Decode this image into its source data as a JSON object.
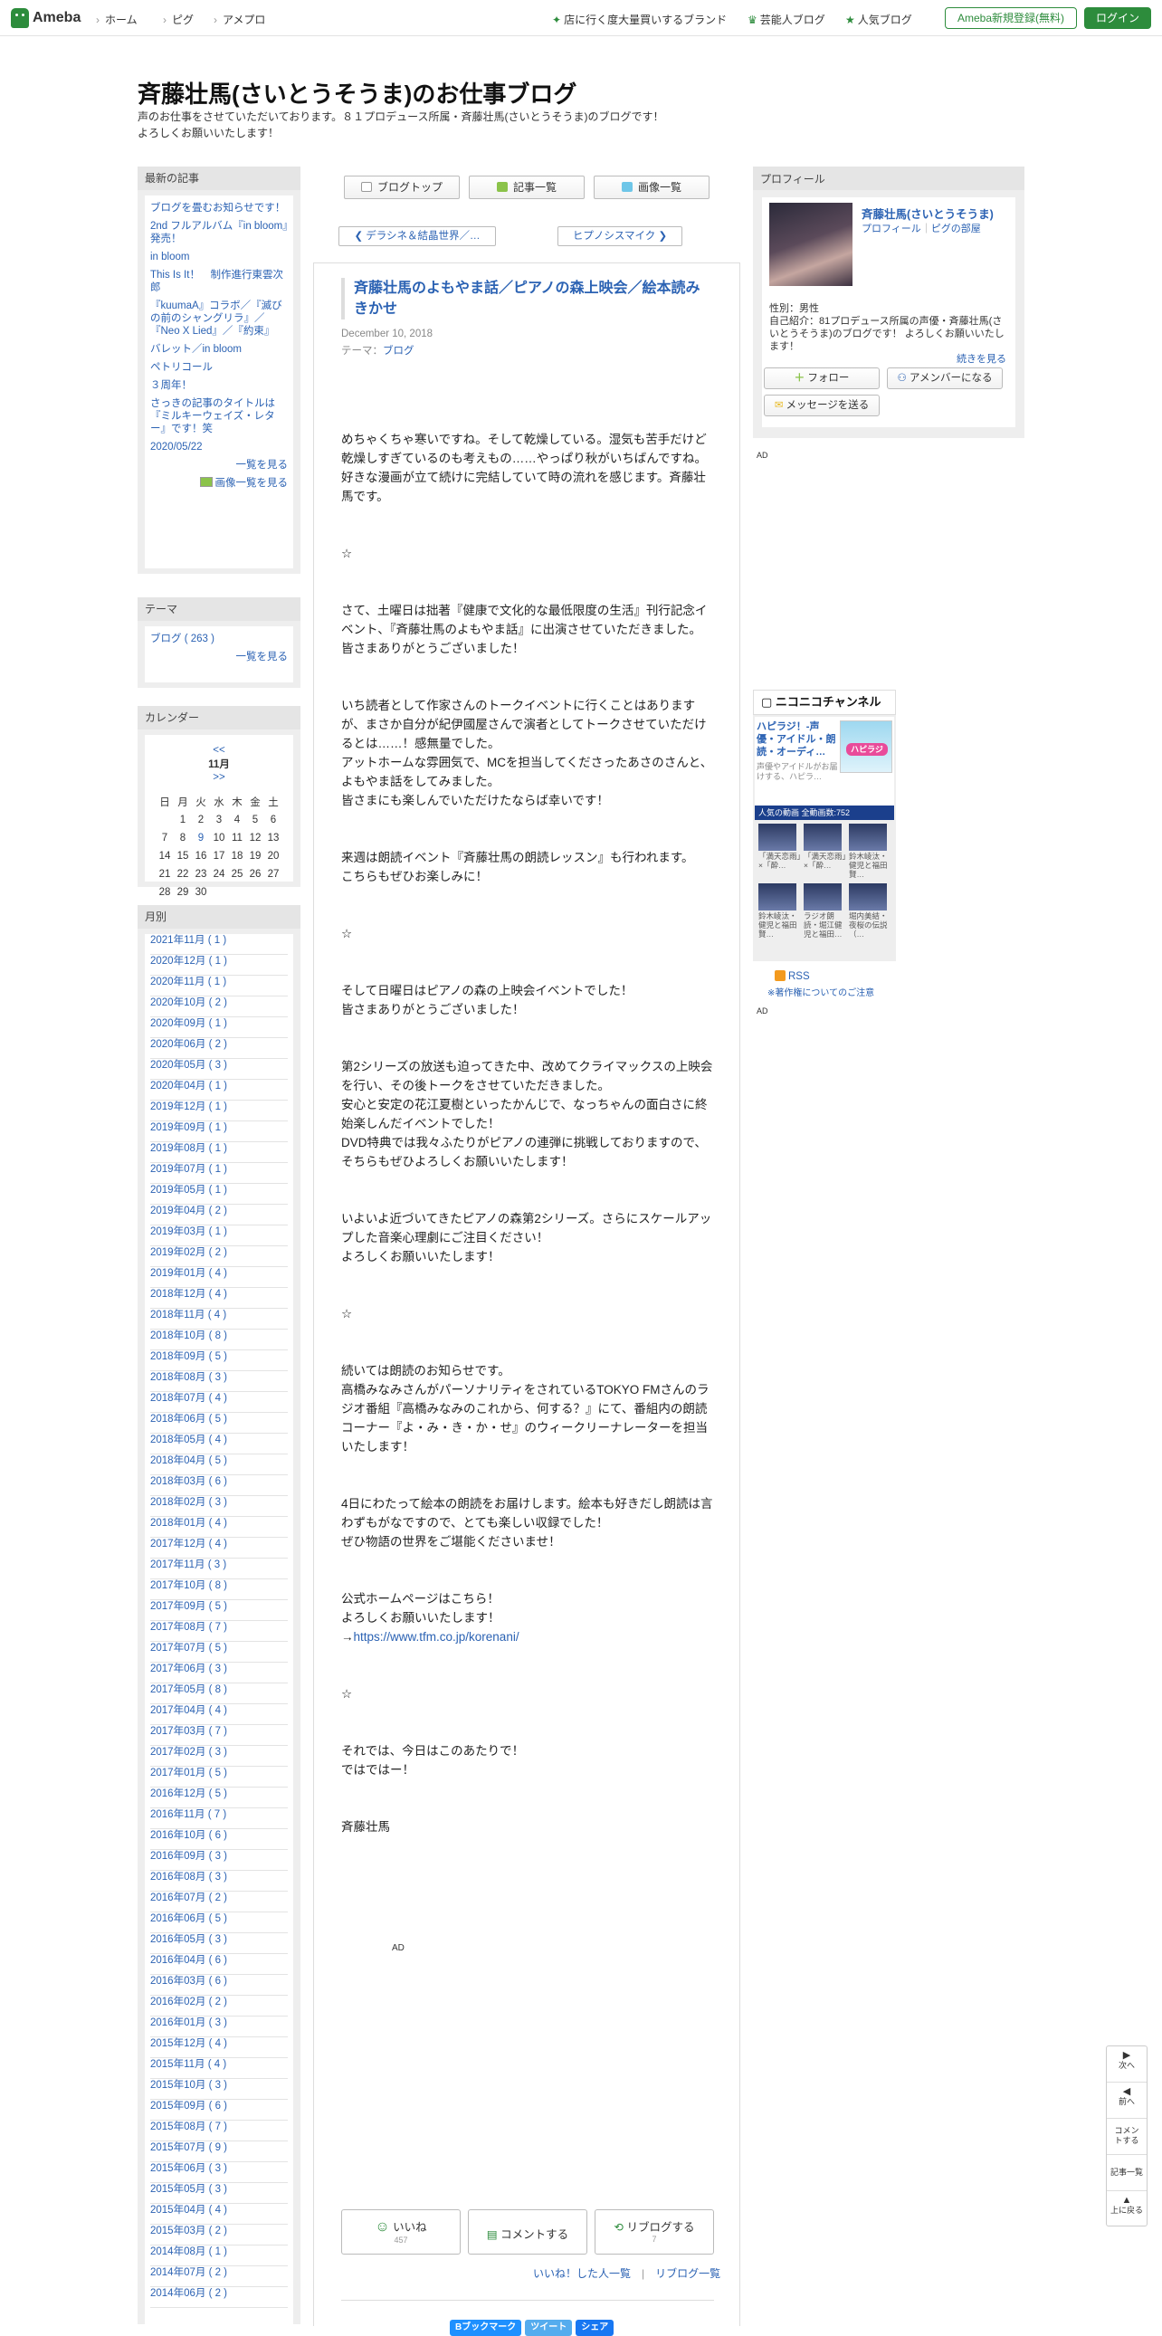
{
  "header": {
    "logo": "Ameba",
    "nav": [
      "ホーム",
      "ピグ",
      "アメプロ"
    ],
    "right_links": [
      "店に行く度大量買いするブランド",
      "芸能人ブログ",
      "人気ブログ"
    ],
    "register": "Ameba新規登録(無料)",
    "login": "ログイン"
  },
  "blog": {
    "title": "斉藤壮馬(さいとうそうま)のお仕事ブログ",
    "description_line1": "声のお仕事をさせていただいております。８１プロデュース所属・斉藤壮馬(さいとうそうま)のブログです！",
    "description_line2": "よろしくお願いいたします！"
  },
  "sidebar": {
    "recent_title": "最新の記事",
    "recent": [
      "ブログを畳むお知らせです！",
      "2nd フルアルバム『in bloom』発売！",
      "in bloom",
      "This Is It！　制作進行東雲次郎",
      "『kuumaA』コラボ／『滅びの前のシャングリラ』／『Neo X Lied』／『約束』",
      "バレット／in bloom",
      "ペトリコール",
      "３周年！",
      "さっきの記事のタイトルは『ミルキーウェイズ・レター』です！笑",
      "2020/05/22"
    ],
    "recent_more": "一覧を見る",
    "image_more": "画像一覧を見る",
    "theme_title": "テーマ",
    "theme_item": "ブログ ( 263 )",
    "theme_more": "一覧を見る",
    "calendar_title": "カレンダー",
    "cal_prev": "<<",
    "cal_month": "11月",
    "cal_next": ">>",
    "cal_days": [
      "日",
      "月",
      "火",
      "水",
      "木",
      "金",
      "土"
    ],
    "cal_rows": [
      [
        "",
        "1",
        "2",
        "3",
        "4",
        "5",
        "6"
      ],
      [
        "7",
        "8",
        "9",
        "10",
        "11",
        "12",
        "13"
      ],
      [
        "14",
        "15",
        "16",
        "17",
        "18",
        "19",
        "20"
      ],
      [
        "21",
        "22",
        "23",
        "24",
        "25",
        "26",
        "27"
      ],
      [
        "28",
        "29",
        "30",
        "",
        "",
        "",
        ""
      ]
    ],
    "months_title": "月別",
    "months": [
      "2021年11月 ( 1 )",
      "2020年12月 ( 1 )",
      "2020年11月 ( 1 )",
      "2020年10月 ( 2 )",
      "2020年09月 ( 1 )",
      "2020年06月 ( 2 )",
      "2020年05月 ( 3 )",
      "2020年04月 ( 1 )",
      "2019年12月 ( 1 )",
      "2019年09月 ( 1 )",
      "2019年08月 ( 1 )",
      "2019年07月 ( 1 )",
      "2019年05月 ( 1 )",
      "2019年04月 ( 2 )",
      "2019年03月 ( 1 )",
      "2019年02月 ( 2 )",
      "2019年01月 ( 4 )",
      "2018年12月 ( 4 )",
      "2018年11月 ( 4 )",
      "2018年10月 ( 8 )",
      "2018年09月 ( 5 )",
      "2018年08月 ( 3 )",
      "2018年07月 ( 4 )",
      "2018年06月 ( 5 )",
      "2018年05月 ( 4 )",
      "2018年04月 ( 5 )",
      "2018年03月 ( 6 )",
      "2018年02月 ( 3 )",
      "2018年01月 ( 4 )",
      "2017年12月 ( 4 )",
      "2017年11月 ( 3 )",
      "2017年10月 ( 8 )",
      "2017年09月 ( 5 )",
      "2017年08月 ( 7 )",
      "2017年07月 ( 5 )",
      "2017年06月 ( 3 )",
      "2017年05月 ( 8 )",
      "2017年04月 ( 4 )",
      "2017年03月 ( 7 )",
      "2017年02月 ( 3 )",
      "2017年01月 ( 5 )",
      "2016年12月 ( 5 )",
      "2016年11月 ( 7 )",
      "2016年10月 ( 6 )",
      "2016年09月 ( 3 )",
      "2016年08月 ( 3 )",
      "2016年07月 ( 2 )",
      "2016年06月 ( 5 )",
      "2016年05月 ( 3 )",
      "2016年04月 ( 6 )",
      "2016年03月 ( 6 )",
      "2016年02月 ( 2 )",
      "2016年01月 ( 3 )",
      "2015年12月 ( 4 )",
      "2015年11月 ( 4 )",
      "2015年10月 ( 3 )",
      "2015年09月 ( 6 )",
      "2015年08月 ( 7 )",
      "2015年07月 ( 9 )",
      "2015年06月 ( 3 )",
      "2015年05月 ( 3 )",
      "2015年04月 ( 4 )",
      "2015年03月 ( 2 )",
      "2014年08月 ( 1 )",
      "2014年07月 ( 2 )",
      "2014年06月 ( 2 )"
    ]
  },
  "center": {
    "btn_top": "ブログトップ",
    "btn_list": "記事一覧",
    "btn_images": "画像一覧",
    "prev": "デラシネ＆結晶世界／…",
    "next": "ヒプノシスマイク",
    "article_title": "斉藤壮馬のよもやま話／ピアノの森上映会／絵本読みきかせ",
    "date": "December 10, 2018",
    "theme_label": "テーマ：",
    "theme": "ブログ",
    "body": [
      "めちゃくちゃ寒いですね。そして乾燥している。湿気も苦手だけど乾燥しすぎているのも考えもの……やっぱり秋がいちばんですね。\n好きな漫画が立て続けに完結していて時の流れを感じます。斉藤壮馬です。",
      "☆",
      "さて、土曜日は拙著『健康で文化的な最低限度の生活』刊行記念イベント、『斉藤壮馬のよもやま話』に出演させていただきました。\n皆さまありがとうございました！",
      "いち読者として作家さんのトークイベントに行くことはありますが、まさか自分が紀伊國屋さんで演者としてトークさせていただけるとは……！感無量でした。\nアットホームな雰囲気で、MCを担当してくださったあさのさんと、よもやま話をしてみました。\n皆さまにも楽しんでいただけたならば幸いです！",
      "来週は朗読イベント『斉藤壮馬の朗読レッスン』も行われます。\nこちらもぜひお楽しみに！",
      "☆",
      "そして日曜日はピアノの森の上映会イベントでした！\n皆さまありがとうございました！",
      "第2シリーズの放送も迫ってきた中、改めてクライマックスの上映会を行い、その後トークをさせていただきました。\n安心と安定の花江夏樹といったかんじで、なっちゃんの面白さに終始楽しんだイベントでした！\nDVD特典では我々ふたりがピアノの連弾に挑戦しておりますので、そちらもぜひよろしくお願いいたします！",
      "いよいよ近づいてきたピアノの森第2シリーズ。さらにスケールアップした音楽心理劇にご注目ください！\nよろしくお願いいたします！",
      "☆",
      "続いては朗読のお知らせです。\n高橋みなみさんがパーソナリティをされているTOKYO FMさんのラジオ番組『高橋みなみのこれから、何する？』にて、番組内の朗読コーナー『よ・み・き・か・せ』のウィークリーナレーターを担当いたします！",
      "4日にわたって絵本の朗読をお届けします。絵本も好きだし朗読は言わずもがなですので、とても楽しい収録でした！\nぜひ物語の世界をご堪能くださいませ！",
      "公式ホームページはこちら！\nよろしくお願いいたします！",
      "☆",
      "それでは、今日はこのあたりで！\nではではー！",
      "斉藤壮馬"
    ],
    "link_prefix": "→",
    "link": "https://www.tfm.co.jp/korenani/",
    "ad": "AD",
    "like": "いいね",
    "like_count": "457",
    "comment": "コメントする",
    "reblog": "リブログする",
    "reblog_count": "7",
    "like_list": "いいね！した人一覧",
    "sep": "|",
    "reblog_list": "リブログ一覧",
    "share_b": "Bブックマーク",
    "share_tw": "ツイート",
    "share_fb": "シェア"
  },
  "right": {
    "profile_title": "プロフィール",
    "name": "斉藤壮馬(さいとうそうま)",
    "profile_link": "プロフィール",
    "sep": "｜",
    "room_link": "ピグの部屋",
    "gender": "性別：男性",
    "intro": "自己紹介：81プロデュース所属の声優・斉藤壮馬(さいとうそうま)のブログです！ よろしくお願いいたします！",
    "continue": "続きを見る",
    "follow": "フォロー",
    "member": "アメンバーになる",
    "message": "メッセージを送る",
    "ad": "AD",
    "nico_title": "ニコニコチャンネル",
    "nico_channel": "ハピラジ！-声優・アイドル・朗読・オーディ…",
    "nico_desc": "声優やアイドルがお届けする、ハピラ…",
    "nico_img": "ハピラジ",
    "nico_popular": "人気の動画",
    "nico_count": "全動画数:752",
    "videos": [
      "「満天恋雨」×「酔…",
      "「満天恋雨」×「酔…",
      "鈴木崚汰・健児と福田賢…",
      "鈴木崚汰・健児と福田賢…",
      "ラジオ朗読・堀江健児と福田…",
      "堀内美結・夜桜の伝説（…"
    ],
    "rss": "RSS",
    "copyright": "※著作権についてのご注意",
    "ad2": "AD"
  },
  "floatnav": [
    "次へ",
    "前へ",
    "コメントする",
    "記事一覧",
    "上に戻る"
  ]
}
